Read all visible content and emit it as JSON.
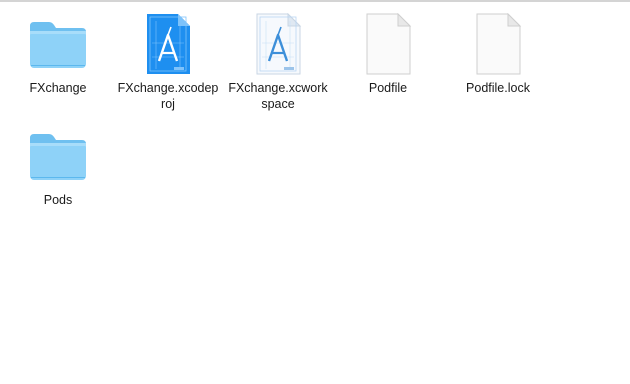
{
  "window": {
    "view": "icon-view"
  },
  "files": [
    {
      "name": "FXchange",
      "icon": "folder-icon"
    },
    {
      "name": "FXchange.xcodeproj",
      "display": "FXchange.xcodep\nroj",
      "icon": "xcode-project-icon"
    },
    {
      "name": "FXchange.xcworkspace",
      "display": "FXchange.xcwork\nspace",
      "icon": "xcode-workspace-icon"
    },
    {
      "name": "Podfile",
      "icon": "blank-document-icon"
    },
    {
      "name": "Podfile.lock",
      "icon": "blank-document-icon"
    },
    {
      "name": "Pods",
      "icon": "folder-icon"
    }
  ],
  "colors": {
    "folder_light": "#8ed2f8",
    "folder_dark": "#5cb8ee",
    "xcode_blue": "#1e8ff0",
    "document_fill": "#fafafa",
    "document_stroke": "#cfcfcf"
  }
}
